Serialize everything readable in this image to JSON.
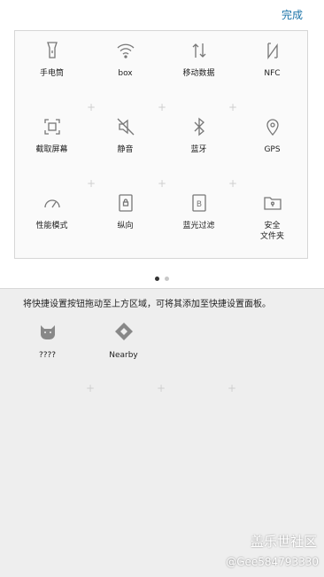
{
  "header": {
    "done_label": "完成"
  },
  "active_tiles": [
    {
      "label": "手电筒",
      "icon": "flashlight-icon"
    },
    {
      "label": "box",
      "icon": "wifi-icon"
    },
    {
      "label": "移动数据",
      "icon": "mobile-data-icon"
    },
    {
      "label": "NFC",
      "icon": "nfc-icon"
    },
    {
      "label": "截取屏幕",
      "icon": "screenshot-icon"
    },
    {
      "label": "静音",
      "icon": "mute-icon"
    },
    {
      "label": "蓝牙",
      "icon": "bluetooth-icon"
    },
    {
      "label": "GPS",
      "icon": "location-icon"
    },
    {
      "label": "性能模式",
      "icon": "performance-gauge-icon"
    },
    {
      "label": "纵向",
      "icon": "portrait-lock-icon"
    },
    {
      "label": "蓝光过滤",
      "icon": "blue-light-filter-icon"
    },
    {
      "label": "安全\n文件夹",
      "icon": "secure-folder-icon"
    }
  ],
  "pager": {
    "pages": 2,
    "current": 1
  },
  "tray": {
    "hint": "将快捷设置按钮拖动至上方区域，可将其添加至快捷设置面板。",
    "items": [
      {
        "label": "????",
        "icon": "cat-face-icon"
      },
      {
        "label": "Nearby",
        "icon": "nearby-diamond-icon"
      }
    ]
  },
  "watermark": {
    "line1": "盖乐世社区",
    "line2": "@Gee584793330"
  },
  "colors": {
    "accent": "#1a73a8",
    "panel_bg": "#fafafa",
    "tray_bg": "#eeeeee"
  }
}
